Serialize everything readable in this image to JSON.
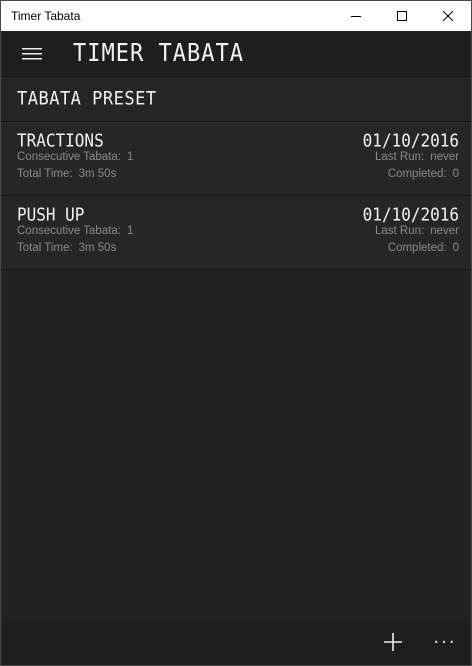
{
  "window": {
    "title": "Timer Tabata",
    "controls": [
      "minimize-icon",
      "maximize-icon",
      "close-icon"
    ]
  },
  "header": {
    "menu_icon": "hamburger-icon",
    "title": "TIMER TABATA"
  },
  "section": {
    "title": "TABATA PRESET"
  },
  "labels": {
    "consecutive": "Consecutive Tabata:",
    "total_time": "Total Time:",
    "last_run": "Last Run:",
    "completed": "Completed:"
  },
  "presets": [
    {
      "name": "TRACTIONS",
      "date": "01/10/2016",
      "consecutive": "1",
      "total_time": "3m 50s",
      "last_run": "never",
      "completed": "0"
    },
    {
      "name": "PUSH UP",
      "date": "01/10/2016",
      "consecutive": "1",
      "total_time": "3m 50s",
      "last_run": "never",
      "completed": "0"
    }
  ],
  "command_bar": {
    "add_icon": "plus-icon",
    "more_label": "···"
  },
  "colors": {
    "background": "#222222",
    "header": "#1e1e1e",
    "text": "#f2f2f2",
    "muted": "#8a8a8a"
  }
}
